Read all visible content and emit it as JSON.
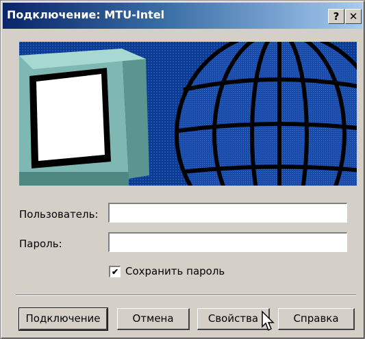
{
  "window": {
    "title": "Подключение: MTU-Intel",
    "help_button": "?",
    "close_button": "✕"
  },
  "form": {
    "user_label": "Пользователь:",
    "user_value": "",
    "password_label": "Пароль:",
    "password_value": "",
    "save_password_label": "Сохранить пароль",
    "save_password_checked": true
  },
  "buttons": {
    "connect": "Подключение",
    "cancel": "Отмена",
    "properties": "Свойства",
    "help": "Справка"
  },
  "icons": {
    "banner": "computer-and-globe-illustration",
    "cursor": "mouse-pointer"
  },
  "colors": {
    "title_active": "#0a246a",
    "face": "#d4d0c8",
    "banner_blue": "#0c2f7a"
  }
}
